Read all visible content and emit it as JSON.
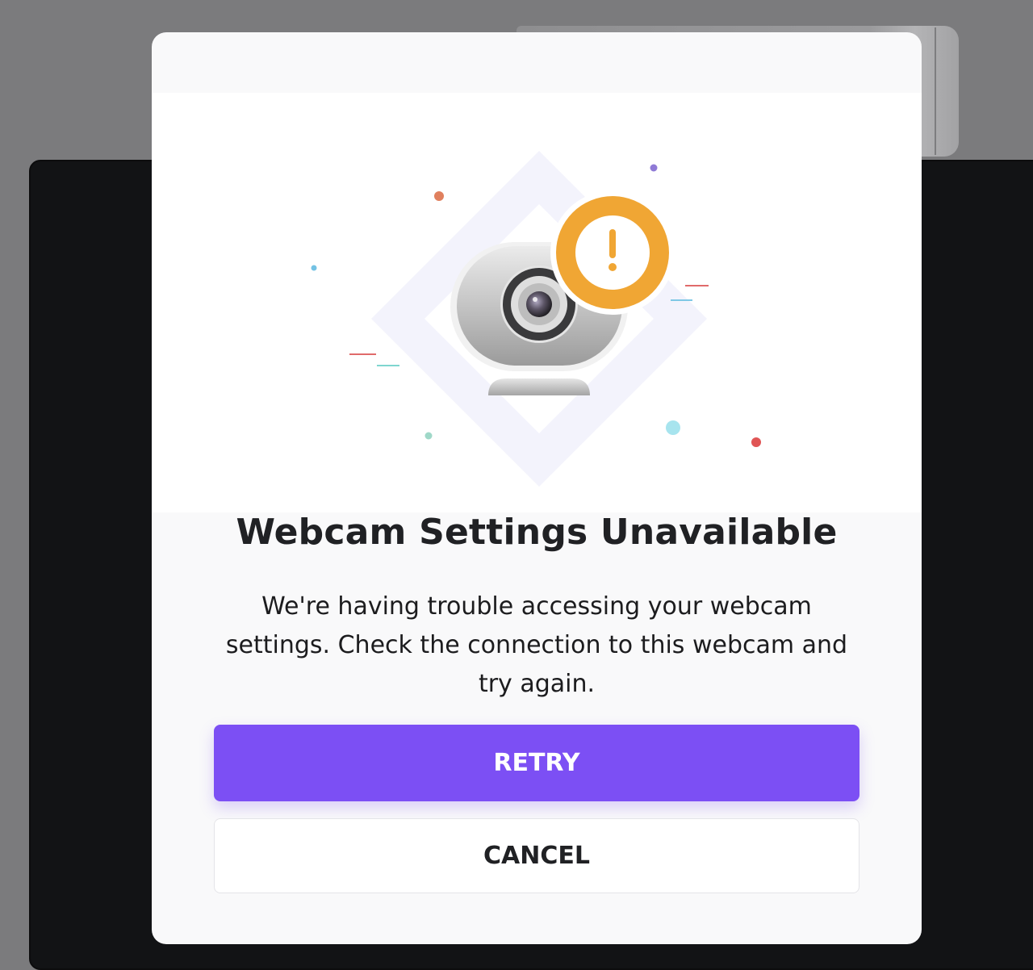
{
  "dialog": {
    "title": "Webcam Settings Unavailable",
    "message": "We're having trouble accessing your webcam settings. Check the connection to this webcam and try again.",
    "retry_label": "RETRY",
    "cancel_label": "CANCEL",
    "illustration_icon": "webcam-warning-icon"
  },
  "colors": {
    "primary": "#7c4ff4",
    "warning": "#f0a634",
    "background_overlay": "#7b7b7d"
  }
}
